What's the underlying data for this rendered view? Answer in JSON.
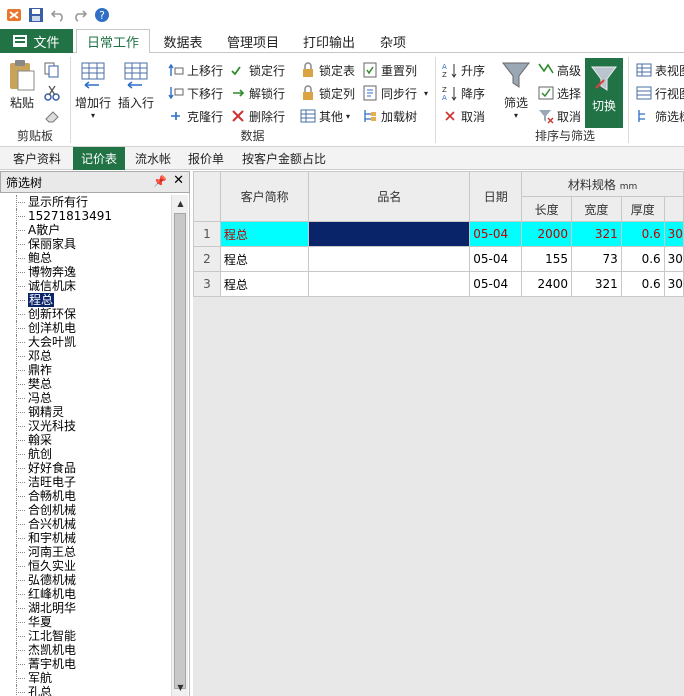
{
  "ribbon_tabs": [
    "文件",
    "日常工作",
    "数据表",
    "管理项目",
    "打印输出",
    "杂项"
  ],
  "active_tab": "日常工作",
  "clipboard": {
    "paste": "粘贴",
    "group": "剪贴板"
  },
  "data_group": {
    "add_row": "增加行",
    "insert_row": "插入行",
    "move_up": "上移行",
    "move_down": "下移行",
    "clone_row": "克隆行",
    "lock_row": "锁定行",
    "unlock_row": "解锁行",
    "delete_row": "删除行",
    "lock_table": "锁定表",
    "lock_col": "锁定列",
    "other": "其他",
    "reset_col": "重置列",
    "sync_row": "同步行",
    "load_tree": "加载树",
    "group": "数据"
  },
  "sort_group": {
    "asc": "升序",
    "desc": "降序",
    "cancel_sort": "取消",
    "filter": "筛选",
    "advanced": "高级",
    "select": "选择",
    "cancel_filter": "取消",
    "switch": "切换",
    "group": "排序与筛选"
  },
  "view_group": {
    "table_view": "表视图",
    "row_view": "行视图",
    "filter_tree": "筛选树"
  },
  "sub_tabs": [
    "客户资料",
    "记价表",
    "流水帐",
    "报价单",
    "按客户金额占比"
  ],
  "active_sub_tab": "记价表",
  "tree": {
    "title": "筛选树",
    "items": [
      "显示所有行",
      "15271813491",
      "A散户",
      "保丽家具",
      "鲍总",
      "博物奔逸",
      "诚信机床",
      "程总",
      "创新环保",
      "创洋机电",
      "大会叶凯",
      "邓总",
      "鼎祚",
      "樊总",
      "冯总",
      "钢精灵",
      "汉光科技",
      "翰采",
      "航创",
      "好好食品",
      "洁旺电子",
      "合畅机电",
      "合创机械",
      "合兴机械",
      "和宇机械",
      "河南王总",
      "恒久实业",
      "弘德机械",
      "红峰机电",
      "湖北明华",
      "华夏",
      "江北智能",
      "杰凯机电",
      "菁宇机电",
      "军航",
      "孔总"
    ],
    "selected": "程总"
  },
  "grid": {
    "headers": {
      "customer": "客户简称",
      "product": "品名",
      "date": "日期",
      "spec_group": "材料规格",
      "spec_unit": "mm",
      "length": "长度",
      "width": "宽度",
      "thickness": "厚度"
    },
    "rows": [
      {
        "no": "1",
        "customer": "程总",
        "product": "",
        "date": "05-04",
        "length": "2000",
        "width": "321",
        "thickness": "0.6",
        "extra": "30"
      },
      {
        "no": "2",
        "customer": "程总",
        "product": "",
        "date": "05-04",
        "length": "155",
        "width": "73",
        "thickness": "0.6",
        "extra": "30"
      },
      {
        "no": "3",
        "customer": "程总",
        "product": "",
        "date": "05-04",
        "length": "2400",
        "width": "321",
        "thickness": "0.6",
        "extra": "30"
      }
    ]
  },
  "colors": {
    "accent": "#217346",
    "current_row": "#00ffff",
    "selection": "#0a246a"
  }
}
